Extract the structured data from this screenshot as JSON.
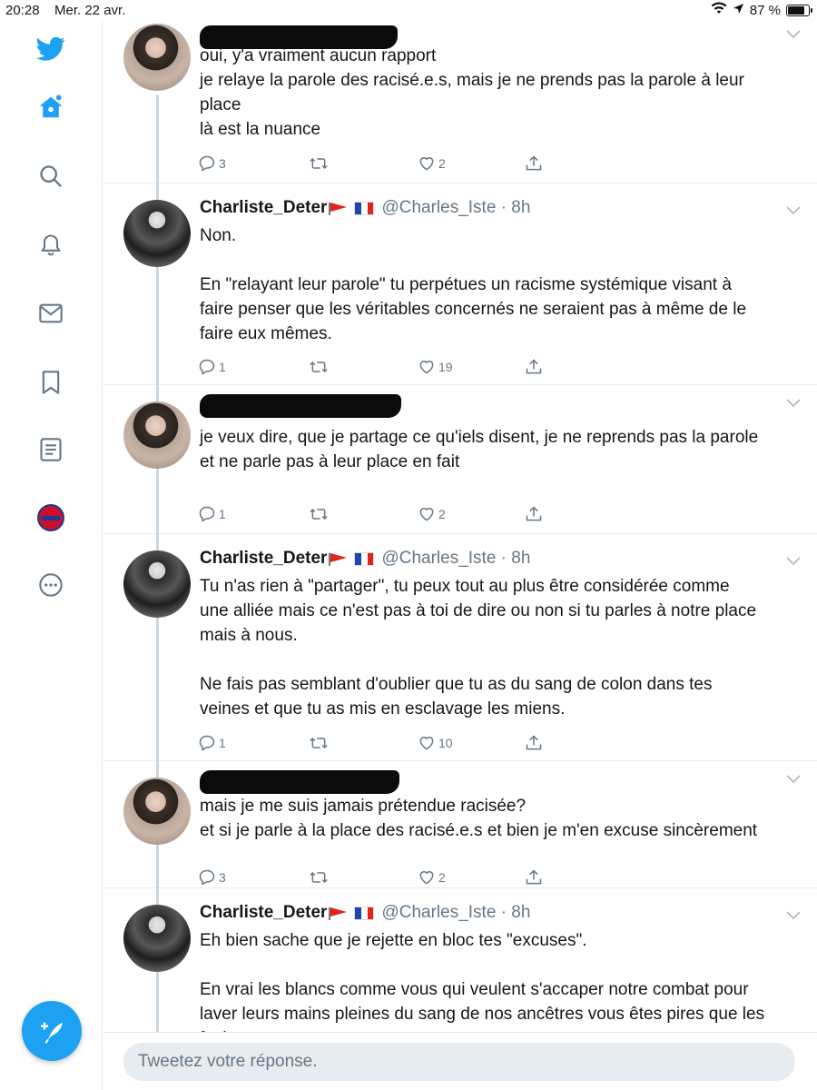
{
  "status_bar": {
    "time": "20:28",
    "date": "Mer. 22 avr.",
    "battery": "87 %",
    "battery_level": 0.87
  },
  "sidebar": {
    "items": [
      "twitter-logo",
      "home",
      "explore",
      "notifications",
      "messages",
      "bookmarks",
      "lists",
      "profile",
      "more"
    ]
  },
  "colors": {
    "accent": "#1da1f2",
    "muted": "#657786",
    "divider": "#e6ecf0"
  },
  "tweets": [
    {
      "author_redacted": true,
      "lines": [
        "oui, y'a vraiment aucun rapport",
        "je relaye la parole des racisé.e.s, mais je ne prends pas la parole à leur",
        "place",
        "là est la nuance"
      ],
      "replies": "3",
      "retweets": "",
      "likes": "2"
    },
    {
      "name": "Charliste_Deter",
      "handle": "@Charles_Iste · 8h",
      "lines": [
        "Non.",
        "",
        "En \"relayant leur parole\" tu perpétues un racisme systémique visant à",
        "faire penser que les véritables concernés ne seraient pas à même de le",
        "faire eux mêmes."
      ],
      "replies": "1",
      "retweets": "",
      "likes": "19"
    },
    {
      "author_redacted": true,
      "lines": [
        "je veux dire, que je partage ce qu'iels disent, je ne reprends pas la parole",
        "et ne parle pas à leur place en fait"
      ],
      "replies": "1",
      "retweets": "",
      "likes": "2"
    },
    {
      "name": "Charliste_Deter",
      "handle": "@Charles_Iste · 8h",
      "lines": [
        "Tu n'as rien à \"partager\", tu peux tout au plus être considérée comme",
        "une alliée mais ce n'est pas à toi de dire ou non si tu parles à notre place",
        "mais à nous.",
        "",
        "Ne fais pas semblant d'oublier que tu as du sang de colon dans tes",
        "veines et que tu as mis en esclavage les miens."
      ],
      "replies": "1",
      "retweets": "",
      "likes": "10"
    },
    {
      "author_redacted": true,
      "lines": [
        "mais je me suis jamais prétendue racisée?",
        "et si je parle à la place des racisé.e.s et bien je m'en excuse sincèrement"
      ],
      "replies": "3",
      "retweets": "",
      "likes": "2"
    },
    {
      "name": "Charliste_Deter",
      "handle": "@Charles_Iste · 8h",
      "lines": [
        "Eh bien sache que je rejette en bloc tes \"excuses\".",
        "",
        "En vrai les blancs comme vous qui veulent s'accaper notre combat pour",
        "laver leurs mains pleines du sang de nos ancêtres vous êtes pires que les",
        "fachos."
      ],
      "replies": "",
      "retweets": "",
      "likes": ""
    }
  ],
  "reply_bar": {
    "placeholder": "Tweetez votre réponse."
  }
}
